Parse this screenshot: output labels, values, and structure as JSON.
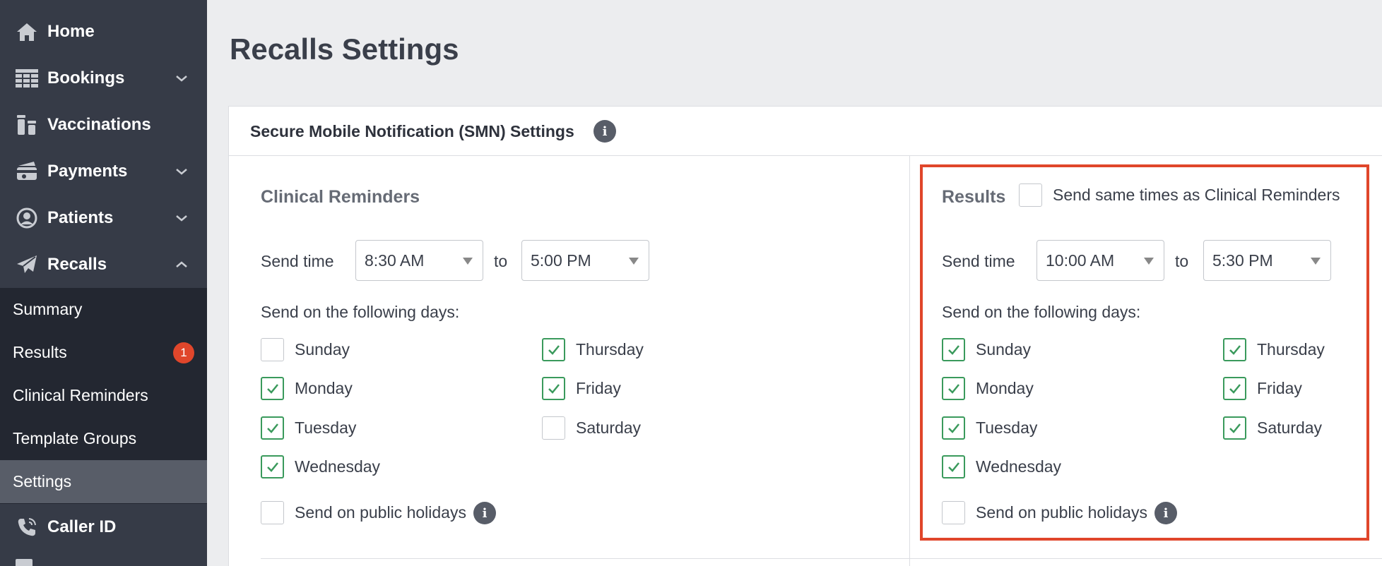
{
  "sidebar": {
    "items": [
      {
        "label": "Home",
        "icon": "home-icon",
        "has_chevron": false
      },
      {
        "label": "Bookings",
        "icon": "grid-icon",
        "has_chevron": true
      },
      {
        "label": "Vaccinations",
        "icon": "vials-icon",
        "has_chevron": false
      },
      {
        "label": "Payments",
        "icon": "credit-card-icon",
        "has_chevron": true
      },
      {
        "label": "Patients",
        "icon": "user-circle-icon",
        "has_chevron": true
      },
      {
        "label": "Recalls",
        "icon": "paper-plane-icon",
        "has_chevron": true,
        "expanded": true
      },
      {
        "label": "Caller ID",
        "icon": "phone-icon",
        "has_chevron": false
      }
    ],
    "recalls_sub": [
      {
        "label": "Summary"
      },
      {
        "label": "Results",
        "badge": "1"
      },
      {
        "label": "Clinical Reminders"
      },
      {
        "label": "Template Groups"
      },
      {
        "label": "Settings",
        "active": true
      }
    ]
  },
  "page": {
    "title": "Recalls Settings"
  },
  "panel": {
    "title": "Secure Mobile Notification (SMN) Settings",
    "info_icon": "i"
  },
  "clinical": {
    "title": "Clinical Reminders",
    "send_time_label": "Send time",
    "from": "8:30 AM",
    "to_label": "to",
    "to": "5:00 PM",
    "days_label": "Send on the following days:",
    "days": [
      {
        "label": "Sunday",
        "checked": false
      },
      {
        "label": "Monday",
        "checked": true
      },
      {
        "label": "Tuesday",
        "checked": true
      },
      {
        "label": "Wednesday",
        "checked": true
      },
      {
        "label": "Thursday",
        "checked": true
      },
      {
        "label": "Friday",
        "checked": true
      },
      {
        "label": "Saturday",
        "checked": false
      }
    ],
    "holidays": {
      "label": "Send on public holidays",
      "checked": false
    }
  },
  "results": {
    "title": "Results",
    "same_times": {
      "label": "Send same times as Clinical Reminders",
      "checked": false
    },
    "send_time_label": "Send time",
    "from": "10:00 AM",
    "to_label": "to",
    "to": "5:30 PM",
    "days_label": "Send on the following days:",
    "days": [
      {
        "label": "Sunday",
        "checked": true
      },
      {
        "label": "Monday",
        "checked": true
      },
      {
        "label": "Tuesday",
        "checked": true
      },
      {
        "label": "Wednesday",
        "checked": true
      },
      {
        "label": "Thursday",
        "checked": true
      },
      {
        "label": "Friday",
        "checked": true
      },
      {
        "label": "Saturday",
        "checked": true
      }
    ],
    "holidays": {
      "label": "Send on public holidays",
      "checked": false
    }
  },
  "colors": {
    "sidebar": "#363b47",
    "subnav": "#232731",
    "active": "#585d68",
    "check": "#3a9a5c",
    "highlight": "#e0462b"
  }
}
